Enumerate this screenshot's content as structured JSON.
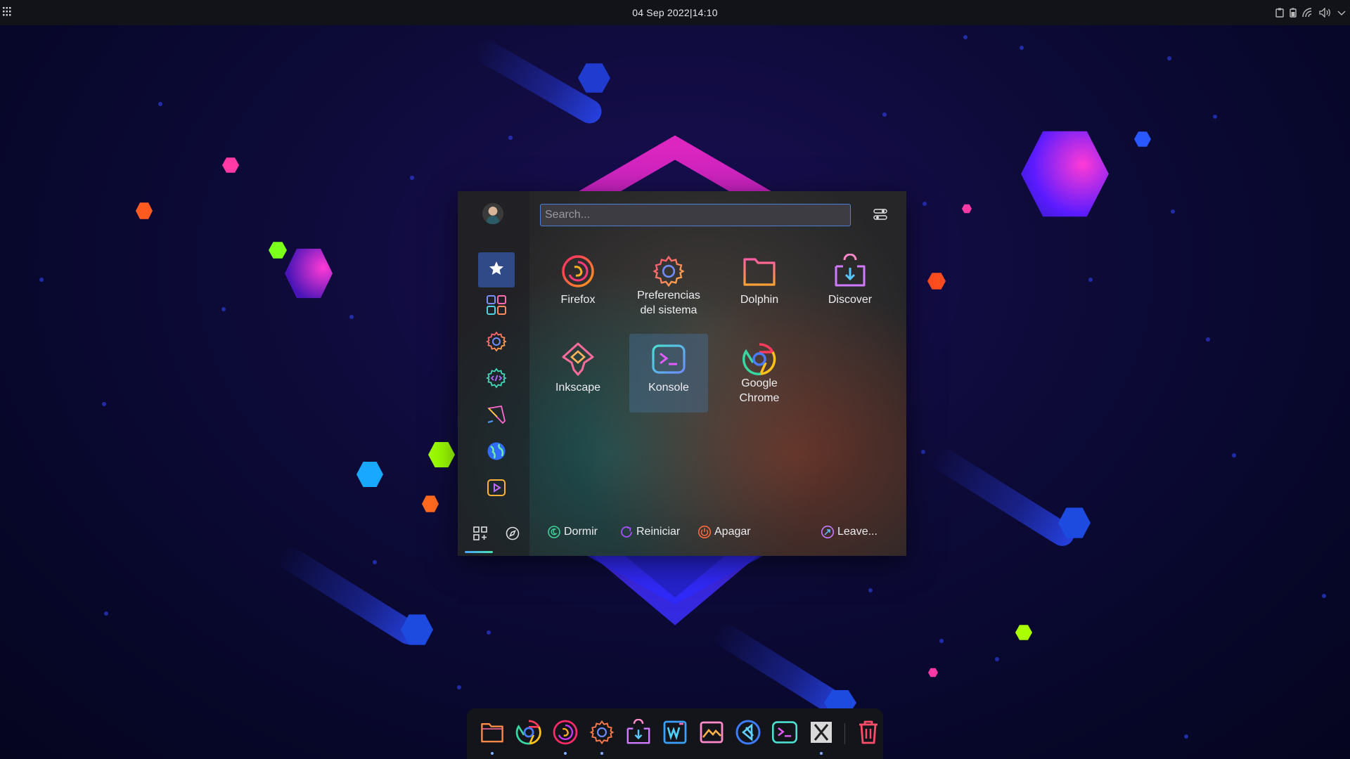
{
  "panel": {
    "clock": "04 Sep 2022|14:10",
    "launcher_icon": "app-grid-icon",
    "tray_icons": [
      "clipboard-icon",
      "battery-icon",
      "network-icon",
      "volume-icon",
      "chevron-down-icon"
    ]
  },
  "menu": {
    "search": {
      "placeholder": "Search..."
    },
    "sidebar": {
      "categories": [
        {
          "name": "favorites",
          "icon": "star-icon",
          "active": true
        },
        {
          "name": "all-applications",
          "icon": "grid-icon",
          "active": false
        },
        {
          "name": "settings",
          "icon": "gear-icon",
          "active": false
        },
        {
          "name": "development",
          "icon": "code-gear-icon",
          "active": false
        },
        {
          "name": "graphics",
          "icon": "pen-icon",
          "active": false
        },
        {
          "name": "internet",
          "icon": "globe-icon",
          "active": false
        },
        {
          "name": "multimedia",
          "icon": "play-icon",
          "active": false
        }
      ],
      "bottom_tabs": [
        {
          "name": "applications-tab",
          "icon": "apps-add-icon"
        },
        {
          "name": "places-tab",
          "icon": "compass-icon"
        }
      ]
    },
    "apps": [
      {
        "label": "Firefox",
        "icon": "firefox-icon"
      },
      {
        "label": "Preferencias del sistema",
        "icon": "settings-icon"
      },
      {
        "label": "Dolphin",
        "icon": "folder-icon"
      },
      {
        "label": "Discover",
        "icon": "discover-icon"
      },
      {
        "label": "Inkscape",
        "icon": "inkscape-icon"
      },
      {
        "label": "Konsole",
        "icon": "terminal-icon",
        "highlighted": true
      },
      {
        "label": "Google Chrome",
        "icon": "chrome-icon"
      }
    ],
    "footer": {
      "sleep": "Dormir",
      "restart": "Reiniciar",
      "shutdown": "Apagar",
      "leave": "Leave..."
    }
  },
  "dock": {
    "items": [
      {
        "name": "dolphin",
        "icon": "folder-icon",
        "running": true
      },
      {
        "name": "chrome",
        "icon": "chrome-icon",
        "running": false
      },
      {
        "name": "firefox",
        "icon": "firefox-icon",
        "running": true
      },
      {
        "name": "system-settings",
        "icon": "settings-icon",
        "running": true
      },
      {
        "name": "discover",
        "icon": "discover-icon",
        "running": false
      },
      {
        "name": "writer",
        "icon": "writer-icon",
        "running": false
      },
      {
        "name": "image-viewer",
        "icon": "image-icon",
        "running": false
      },
      {
        "name": "vscode",
        "icon": "vscode-icon",
        "running": false
      },
      {
        "name": "konsole",
        "icon": "terminal-icon",
        "running": false
      },
      {
        "name": "xorg",
        "icon": "x-app-icon",
        "running": true
      },
      {
        "name": "trash",
        "icon": "trash-icon",
        "running": false
      }
    ]
  },
  "colors": {
    "accent": "#2f4a86",
    "search_border": "#4e7fd6",
    "panel_bg": "#111318",
    "wallpaper_base": "#0e0b3a"
  }
}
